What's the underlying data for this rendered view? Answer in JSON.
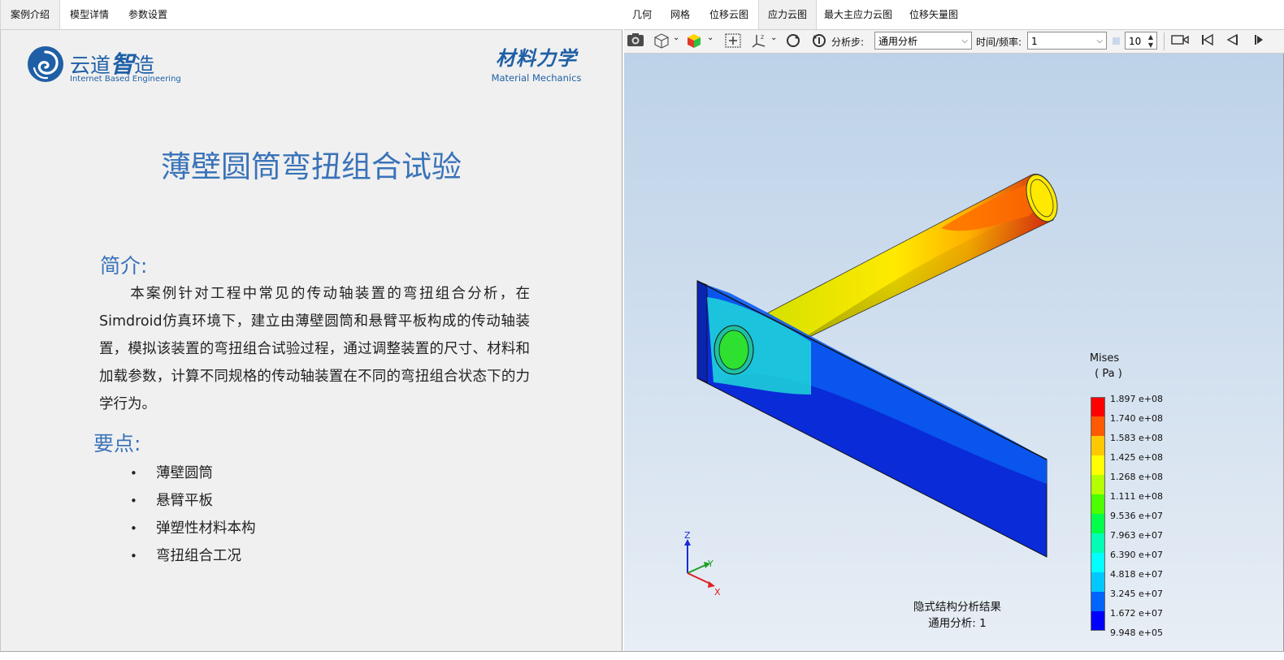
{
  "left_tabs": [
    {
      "label": "案例介绍",
      "active": true
    },
    {
      "label": "模型详情",
      "active": false
    },
    {
      "label": "参数设置",
      "active": false
    }
  ],
  "right_tabs": [
    {
      "label": "几何",
      "active": false
    },
    {
      "label": "网格",
      "active": false
    },
    {
      "label": "位移云图",
      "active": false
    },
    {
      "label": "应力云图",
      "active": true
    },
    {
      "label": "最大主应力云图",
      "active": false
    },
    {
      "label": "位移矢量图",
      "active": false
    }
  ],
  "logo": {
    "cn_part1": "云道",
    "cn_part2": "智",
    "cn_part3": "造",
    "en": "Internet Based Engineering",
    "brand_color": "#1f5fa6"
  },
  "course_logo": {
    "cn": "材料力学",
    "en": "Material Mechanics"
  },
  "intro": {
    "title": "薄壁圆筒弯扭组合试验",
    "intro_heading": "简介:",
    "intro_text": "本案例针对工程中常见的传动轴装置的弯扭组合分析，在Simdroid仿真环境下，建立由薄壁圆筒和悬臂平板构成的传动轴装置，模拟该装置的弯扭组合试验过程，通过调整装置的尺寸、材料和加载参数，计算不同规格的传动轴装置在不同的弯扭组合状态下的力学行为。",
    "points_heading": "要点:",
    "points": [
      "薄壁圆筒",
      "悬臂平板",
      "弹塑性材料本构",
      "弯扭组合工况"
    ],
    "accent_color": "#3a73b9"
  },
  "toolbar": {
    "step_label": "分析步:",
    "step_value": "通用分析",
    "time_label": "时间/频率:",
    "time_value": "1",
    "frame_count": "10",
    "icons": [
      "camera-icon",
      "cube-view-icon",
      "color-cube-icon",
      "fit-view-icon",
      "axis-icon",
      "rotate-icon",
      "reset-rotate-icon",
      "record-icon",
      "first-frame-icon",
      "prev-frame-icon",
      "next-frame-icon"
    ]
  },
  "legend": {
    "title": "Mises",
    "unit": "( Pa )",
    "colors": [
      "#ff0000",
      "#ff5a00",
      "#ffc800",
      "#ffff00",
      "#b4ff00",
      "#4bff00",
      "#00ff4b",
      "#00ffb4",
      "#00ffff",
      "#00c8ff",
      "#0064ff",
      "#0000ff"
    ],
    "values": [
      "1.897 e+08",
      "1.740 e+08",
      "1.583 e+08",
      "1.425 e+08",
      "1.268 e+08",
      "1.111 e+08",
      "9.536 e+07",
      "7.963 e+07",
      "6.390 e+07",
      "4.818 e+07",
      "3.245 e+07",
      "1.672 e+07",
      "9.948 e+05"
    ]
  },
  "caption": {
    "line1": "隐式结构分析结果",
    "line2": "通用分析: 1"
  },
  "axes": {
    "z": "Z",
    "y": "Y",
    "x": "X"
  }
}
